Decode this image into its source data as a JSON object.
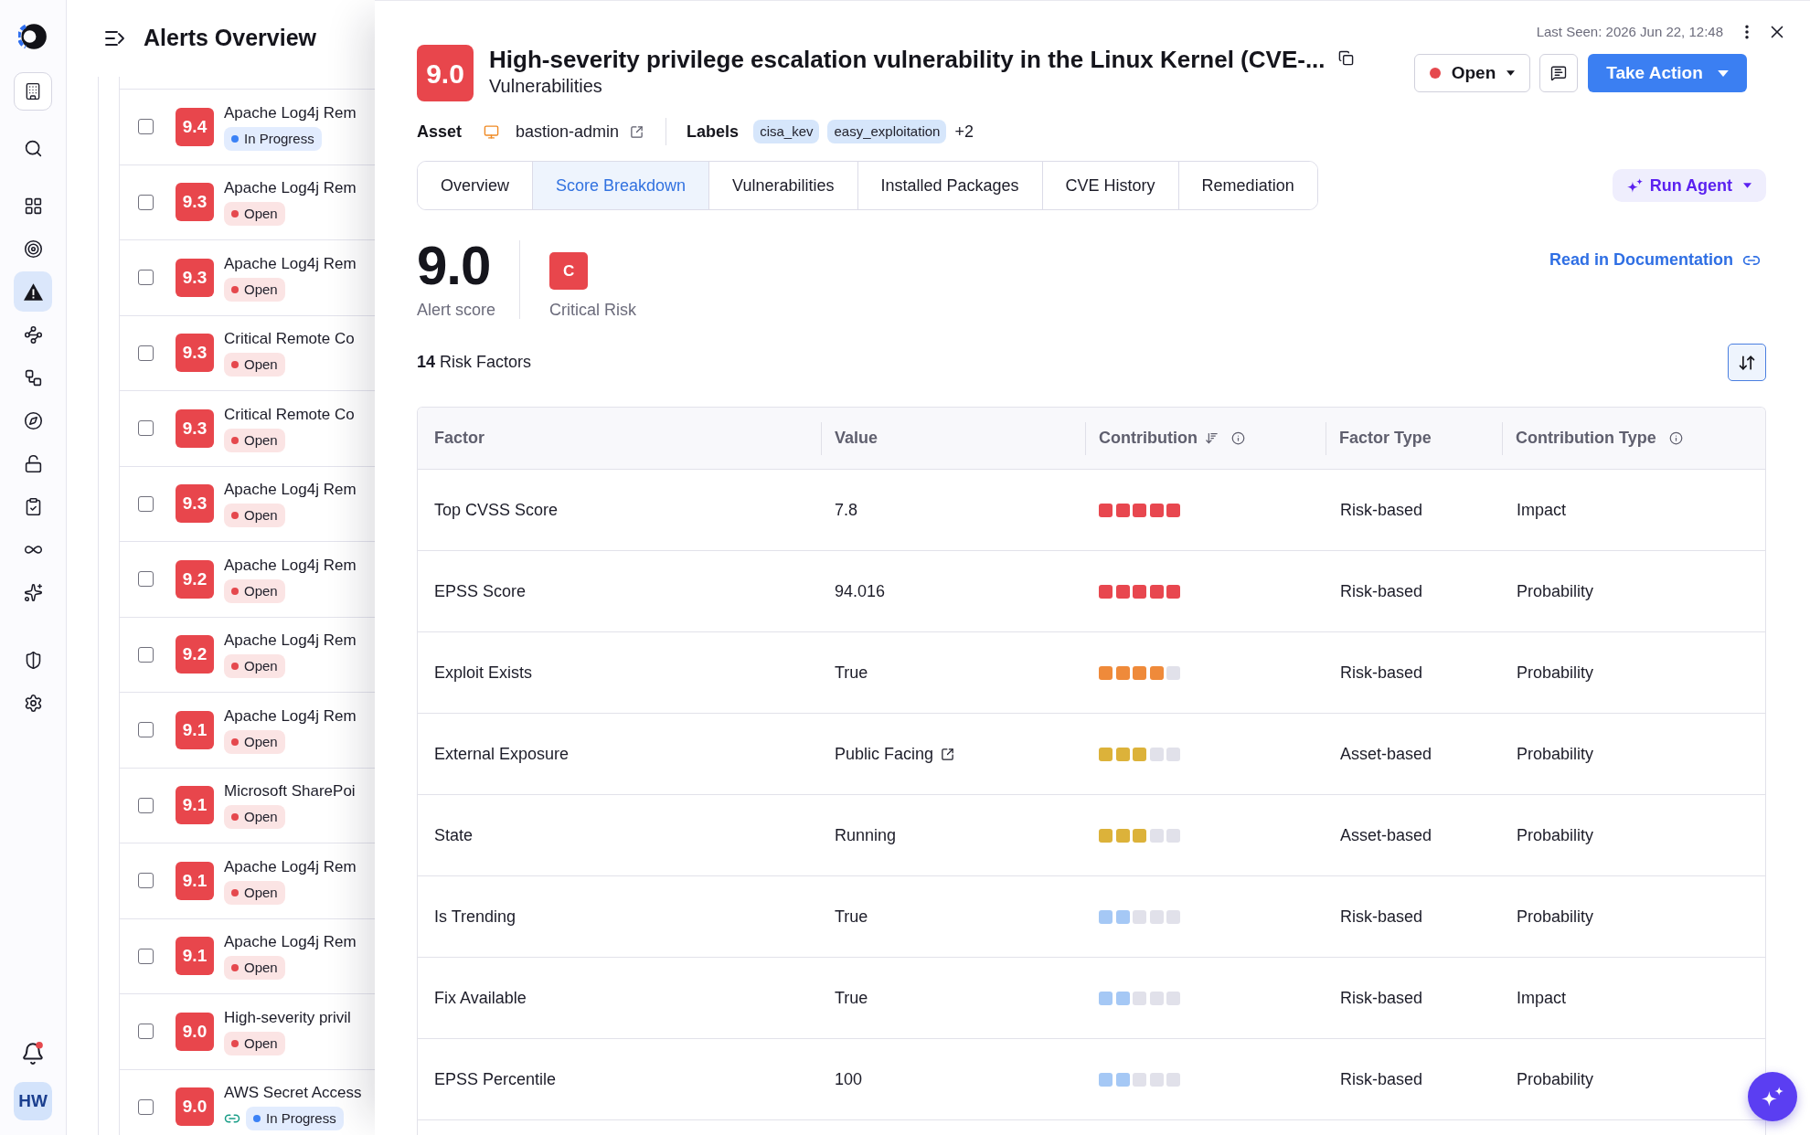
{
  "nav_rail": {
    "groups": [
      {
        "items": [
          {
            "selected": false
          }
        ]
      },
      {
        "items": [
          {
            "selected": false
          },
          {
            "selected": false
          },
          {
            "selected": true
          },
          {
            "selected": false
          },
          {
            "selected": false
          },
          {
            "selected": false
          },
          {
            "selected": false
          },
          {
            "selected": false
          },
          {
            "selected": false
          },
          {
            "selected": false
          }
        ]
      },
      {
        "items": [
          {
            "selected": false
          },
          {
            "selected": false
          }
        ]
      }
    ],
    "notifications": {
      "unread": true
    },
    "user": {
      "initials": "HW"
    }
  },
  "alerts_panel": {
    "title": "Alerts Overview",
    "alerts": [
      {
        "checked": false,
        "score": "9.4",
        "title": "Apache Log4j Rem",
        "status": {
          "label": "In Progress",
          "color": "#3b82f6"
        }
      },
      {
        "checked": false,
        "score": "9.3",
        "title": "Apache Log4j Rem",
        "status": {
          "label": "Open",
          "color": "#e5484d"
        }
      },
      {
        "checked": false,
        "score": "9.3",
        "title": "Apache Log4j Rem",
        "status": {
          "label": "Open",
          "color": "#e5484d"
        }
      },
      {
        "checked": false,
        "score": "9.3",
        "title": "Critical Remote Co",
        "status": {
          "label": "Open",
          "color": "#e5484d"
        }
      },
      {
        "checked": false,
        "score": "9.3",
        "title": "Critical Remote Co",
        "status": {
          "label": "Open",
          "color": "#e5484d"
        }
      },
      {
        "checked": false,
        "score": "9.3",
        "title": "Apache Log4j Rem",
        "status": {
          "label": "Open",
          "color": "#e5484d"
        }
      },
      {
        "checked": false,
        "score": "9.2",
        "title": "Apache Log4j Rem",
        "status": {
          "label": "Open",
          "color": "#e5484d"
        }
      },
      {
        "checked": false,
        "score": "9.2",
        "title": "Apache Log4j Rem",
        "status": {
          "label": "Open",
          "color": "#e5484d"
        }
      },
      {
        "checked": false,
        "score": "9.1",
        "title": "Apache Log4j Rem",
        "status": {
          "label": "Open",
          "color": "#e5484d"
        }
      },
      {
        "checked": false,
        "score": "9.1",
        "title": "Microsoft SharePoi",
        "status": {
          "label": "Open",
          "color": "#e5484d"
        }
      },
      {
        "checked": false,
        "score": "9.1",
        "title": "Apache Log4j Rem",
        "status": {
          "label": "Open",
          "color": "#e5484d"
        }
      },
      {
        "checked": false,
        "score": "9.1",
        "title": "Apache Log4j Rem",
        "status": {
          "label": "Open",
          "color": "#e5484d"
        }
      },
      {
        "checked": false,
        "score": "9.0",
        "title": "High-severity privil",
        "status": {
          "label": "Open",
          "color": "#e5484d"
        }
      },
      {
        "checked": false,
        "score": "9.0",
        "title": "AWS Secret Access",
        "linked": true,
        "status": {
          "label": "In Progress",
          "color": "#3b82f6"
        }
      }
    ]
  },
  "alert_detail": {
    "last_seen": "Last Seen: 2026 Jun 22, 12:48",
    "score": "9.0",
    "title": "High-severity privilege escalation vulnerability in the Linux Kernel (CVE-...",
    "category": "Vulnerabilities",
    "status": {
      "label": "Open",
      "color": "#e5484d"
    },
    "primary_action": "Take Action",
    "asset": {
      "label": "Asset",
      "name": "bastion-admin"
    },
    "labels": {
      "label": "Labels",
      "tags": [
        "cisa_kev",
        "easy_exploitation"
      ],
      "more": "+2"
    },
    "tabs": [
      {
        "label": "Overview",
        "selected": false
      },
      {
        "label": "Score Breakdown",
        "selected": true
      },
      {
        "label": "Vulnerabilities",
        "selected": false
      },
      {
        "label": "Installed Packages",
        "selected": false
      },
      {
        "label": "CVE History",
        "selected": false
      },
      {
        "label": "Remediation",
        "selected": false
      }
    ],
    "run_agent": "Run Agent",
    "score_breakdown": {
      "alert_score": "9.0",
      "alert_score_label": "Alert score",
      "risk_grade": "C",
      "risk_label": "Critical Risk",
      "documentation_link": "Read in Documentation",
      "risk_factors_summary": "**14** Risk Factors",
      "table": {
        "columns": [
          {
            "label": "Factor"
          },
          {
            "label": "Value"
          },
          {
            "label": "Contribution",
            "sorted_descending": true,
            "info": true
          },
          {
            "label": "Factor Type"
          },
          {
            "label": "Contribution Type",
            "info": true
          }
        ],
        "rows": [
          {
            "factor": "Top CVSS Score",
            "value": "7.8",
            "contribution": {
              "stars": 5,
              "color": "#e8474f"
            },
            "factor_type": "Risk-based",
            "contribution_type": "Impact"
          },
          {
            "factor": "EPSS Score",
            "value": "94.016",
            "contribution": {
              "stars": 5,
              "color": "#e8474f"
            },
            "factor_type": "Risk-based",
            "contribution_type": "Probability"
          },
          {
            "factor": "Exploit Exists",
            "value": "True",
            "contribution": {
              "stars": 4,
              "color": "#ef8a3a"
            },
            "factor_type": "Risk-based",
            "contribution_type": "Probability"
          },
          {
            "factor": "External Exposure",
            "value": "Public Facing",
            "external_link": true,
            "contribution": {
              "stars": 3,
              "color": "#dcb23a"
            },
            "factor_type": "Asset-based",
            "contribution_type": "Probability"
          },
          {
            "factor": "State",
            "value": "Running",
            "contribution": {
              "stars": 3,
              "color": "#dcb23a"
            },
            "factor_type": "Asset-based",
            "contribution_type": "Probability"
          },
          {
            "factor": "Is Trending",
            "value": "True",
            "contribution": {
              "stars": 2,
              "color": "#a5c8f5"
            },
            "factor_type": "Risk-based",
            "contribution_type": "Probability"
          },
          {
            "factor": "Fix Available",
            "value": "True",
            "contribution": {
              "stars": 2,
              "color": "#a5c8f5"
            },
            "factor_type": "Risk-based",
            "contribution_type": "Impact"
          },
          {
            "factor": "EPSS Percentile",
            "value": "100",
            "contribution": {
              "stars": 2,
              "color": "#a5c8f5"
            },
            "factor_type": "Risk-based",
            "contribution_type": "Probability"
          }
        ]
      }
    }
  }
}
